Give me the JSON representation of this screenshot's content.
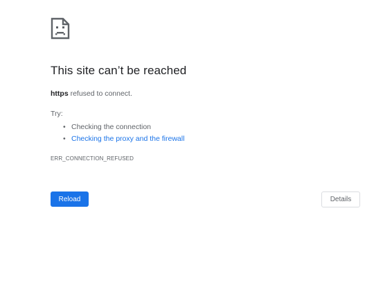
{
  "icon": "sad-page-icon",
  "title": "This site can’t be reached",
  "subtitle": {
    "host": "https",
    "message": " refused to connect."
  },
  "try_label": "Try:",
  "suggestions": [
    {
      "text": "Checking the connection",
      "is_link": false
    },
    {
      "text": "Checking the proxy and the firewall",
      "is_link": true
    }
  ],
  "error_code": "ERR_CONNECTION_REFUSED",
  "buttons": {
    "reload_label": "Reload",
    "details_label": "Details"
  },
  "colors": {
    "accent": "#1a73e8",
    "text": "#202124",
    "secondary_text": "#5f6368",
    "border": "#dadce0"
  }
}
